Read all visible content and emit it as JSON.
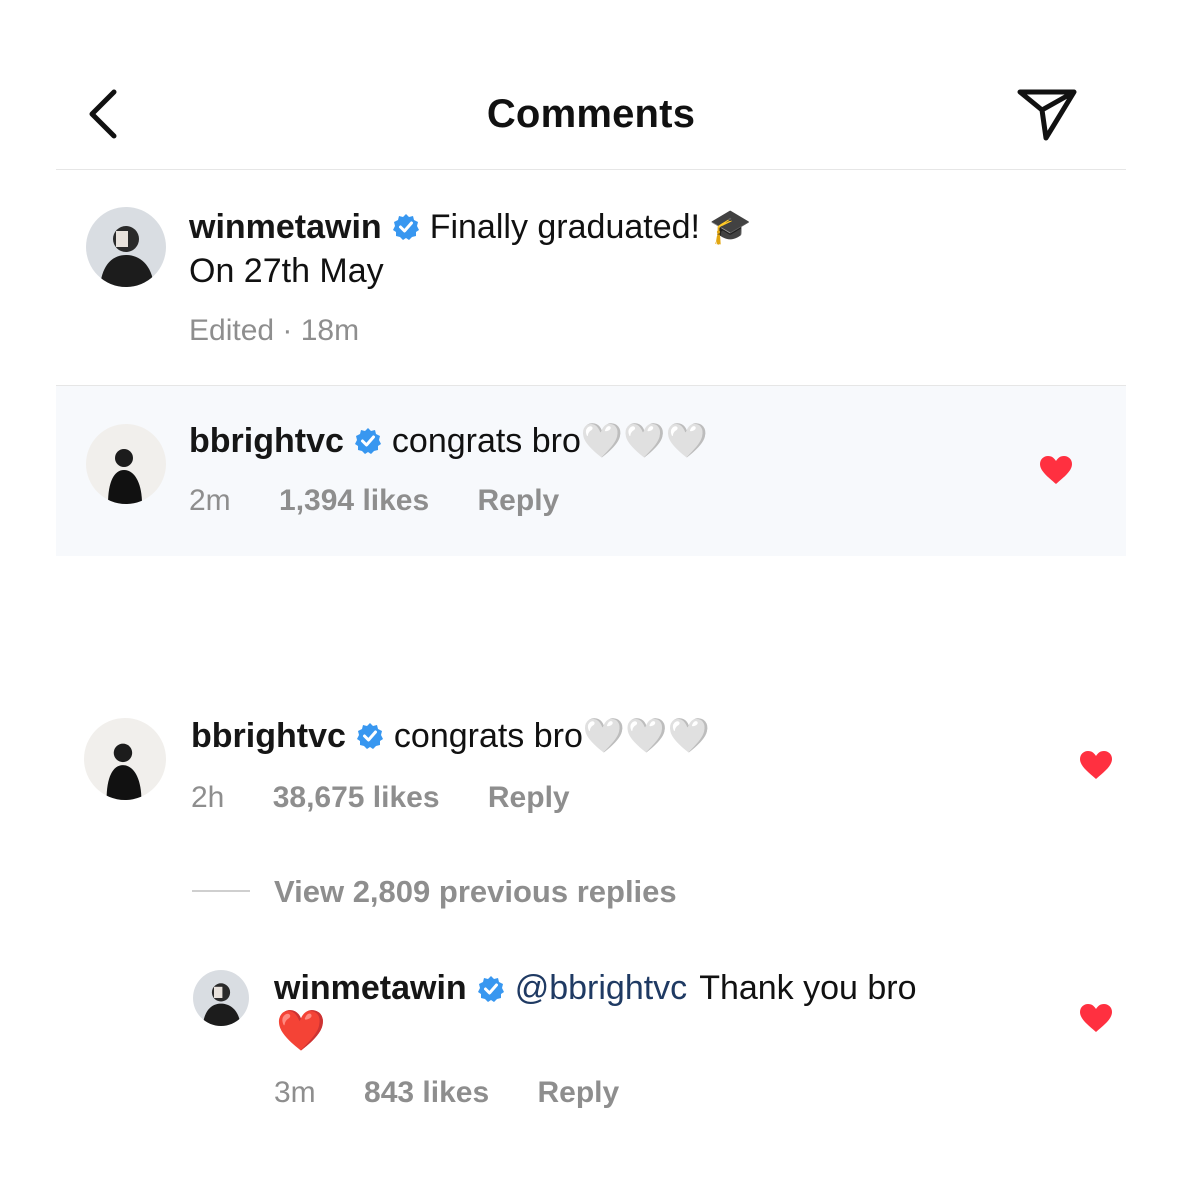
{
  "header": {
    "title": "Comments",
    "back_icon": "chevron-left-icon",
    "share_icon": "paper-plane-icon"
  },
  "caption": {
    "username": "winmetawin",
    "text": "Finally graduated! 🎓",
    "text_line2": "On 27th May",
    "meta": "Edited · 18m"
  },
  "comment_1": {
    "username": "bbrightvc",
    "text": "congrats bro🤍🤍🤍",
    "time": "2m",
    "likes": "1,394 likes",
    "reply_label": "Reply",
    "liked": true
  },
  "comment_2": {
    "username": "bbrightvc",
    "text": "congrats bro🤍🤍🤍",
    "time": "2h",
    "likes": "38,675 likes",
    "reply_label": "Reply",
    "liked": true
  },
  "view_replies": "View 2,809 previous replies",
  "reply_1": {
    "username": "winmetawin",
    "mention": "@bbrightvc",
    "text": "Thank you bro",
    "text_line2": "❤️",
    "time": "3m",
    "likes": "843 likes",
    "reply_label": "Reply",
    "liked": true
  },
  "colors": {
    "verified": "#3897f0",
    "heart": "#ff3040",
    "meta": "#8e8e8e",
    "mention": "#1f3a63",
    "highlight_bg": "#f7f9fc"
  }
}
